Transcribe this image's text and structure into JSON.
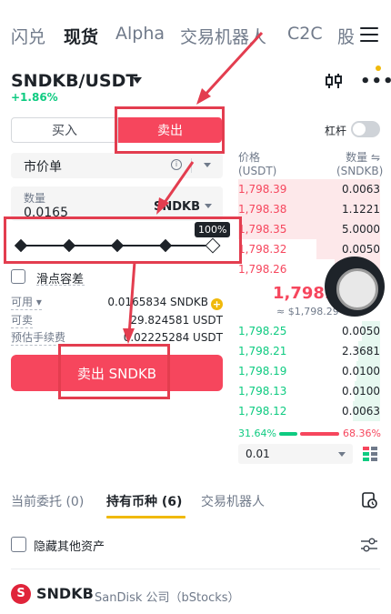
{
  "nav": {
    "tabs": [
      {
        "label": "闪兑"
      },
      {
        "label": "现货"
      },
      {
        "label": "Alpha"
      },
      {
        "label": "交易机器人"
      },
      {
        "label": "C2C"
      },
      {
        "label": "股"
      }
    ]
  },
  "pair": {
    "symbol": "SNDKB/USDT",
    "change": "+1.86%"
  },
  "trade": {
    "buy_label": "买入",
    "sell_label": "卖出",
    "leverage_label": "杠杆",
    "order_type": "市价单",
    "info_icon": "i",
    "qty_label": "数量",
    "qty_value": "0.0165",
    "qty_unit": "SNDKB",
    "slider_percent": 100,
    "slider_tip": "100%",
    "slippage_label": "滑点容差",
    "available_label": "可用",
    "available_value": "0.0165834 SNDKB",
    "sellable_label": "可卖",
    "sellable_value": "29.824581 USDT",
    "fee_label": "预估手续费",
    "fee_value": "0.02225284 USDT",
    "submit_label": "卖出 SNDKB"
  },
  "orderbook": {
    "price_header": "价格",
    "price_unit": "(USDT)",
    "qty_header": "数量",
    "qty_unit": "(SNDKB)",
    "asks": [
      {
        "price": "1,798.39",
        "qty": "0.0063"
      },
      {
        "price": "1,798.38",
        "qty": "1.1221"
      },
      {
        "price": "1,798.35",
        "qty": "5.0000"
      },
      {
        "price": "1,798.32",
        "qty": "0.0050"
      },
      {
        "price": "1,798.26",
        "qty": ""
      }
    ],
    "mid_price": "1,798.",
    "mid_sub": "≈ $1,798.29",
    "bids": [
      {
        "price": "1,798.25",
        "qty": "0.0050"
      },
      {
        "price": "1,798.21",
        "qty": "2.3681"
      },
      {
        "price": "1,798.19",
        "qty": "0.0100"
      },
      {
        "price": "1,798.13",
        "qty": "0.0100"
      },
      {
        "price": "1,798.12",
        "qty": "0.0063"
      }
    ],
    "buy_ratio": "31.64%",
    "sell_ratio": "68.36%",
    "precision": "0.01"
  },
  "bottom": {
    "tabs": [
      {
        "label": "当前委托 (0)"
      },
      {
        "label": "持有币种 (6)"
      },
      {
        "label": "交易机器人"
      }
    ],
    "hide_label": "隐藏其他资产",
    "asset_symbol": "SNDKB",
    "asset_name": "SanDisk 公司（bStocks）"
  },
  "colors": {
    "sell": "#f6465d",
    "buy": "#0ecb81",
    "accent": "#f0b90b",
    "annotation": "#e33d4f"
  }
}
